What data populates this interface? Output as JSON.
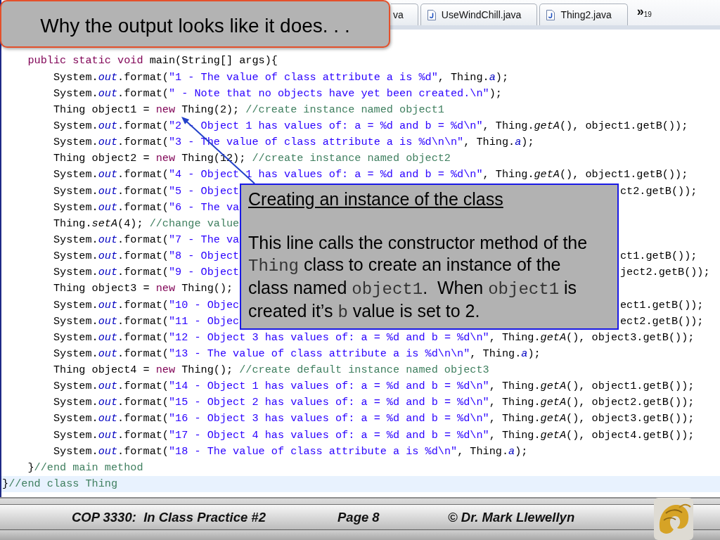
{
  "slide_title": "Why the output looks like it does. . .",
  "editor": {
    "tabs": [
      {
        "label": "va",
        "kind": "partial",
        "selected": false
      },
      {
        "label": "UseWindChill.java",
        "kind": "file",
        "selected": false
      },
      {
        "label": "Thing2.java",
        "kind": "file",
        "selected": false
      }
    ],
    "overflow": {
      "symbol": "»",
      "count": "19"
    },
    "code": [
      {
        "children": [
          {
            "segments": [
              {
                "kind": "keyword",
                "text": "public static void"
              },
              {
                "kind": "plain",
                "text": " main(String[] args){"
              }
            ],
            "highlighted": false,
            "children": [
              {
                "segments": [
                  {
                    "kind": "plain",
                    "text": "System."
                  },
                  {
                    "kind": "field",
                    "text": "out"
                  },
                  {
                    "kind": "plain",
                    "text": ".format("
                  },
                  {
                    "kind": "string",
                    "text": "\"1 - The value of class attribute a is %d\""
                  },
                  {
                    "kind": "plain",
                    "text": ", Thing."
                  },
                  {
                    "kind": "field",
                    "text": "a"
                  },
                  {
                    "kind": "plain",
                    "text": ");"
                  }
                ],
                "highlighted": false
              },
              {
                "segments": [
                  {
                    "kind": "plain",
                    "text": "System."
                  },
                  {
                    "kind": "field",
                    "text": "out"
                  },
                  {
                    "kind": "plain",
                    "text": ".format("
                  },
                  {
                    "kind": "string",
                    "text": "\" - Note that no objects have yet been created.\\n\""
                  },
                  {
                    "kind": "plain",
                    "text": ");"
                  }
                ],
                "highlighted": false
              },
              {
                "segments": [
                  {
                    "kind": "plain",
                    "text": "Thing object1 = "
                  },
                  {
                    "kind": "keyword",
                    "text": "new"
                  },
                  {
                    "kind": "plain",
                    "text": " Thing(2); "
                  },
                  {
                    "kind": "comment",
                    "text": "//create instance named object1"
                  }
                ],
                "highlighted": false
              },
              {
                "segments": [
                  {
                    "kind": "plain",
                    "text": "System."
                  },
                  {
                    "kind": "field",
                    "text": "out"
                  },
                  {
                    "kind": "plain",
                    "text": ".format("
                  },
                  {
                    "kind": "string",
                    "text": "\"2 - Object 1 has values of: a = %d and b = %d\\n\""
                  },
                  {
                    "kind": "plain",
                    "text": ", Thing."
                  },
                  {
                    "kind": "static",
                    "text": "getA"
                  },
                  {
                    "kind": "plain",
                    "text": "(), object1.getB());"
                  }
                ],
                "highlighted": false
              },
              {
                "segments": [
                  {
                    "kind": "plain",
                    "text": "System."
                  },
                  {
                    "kind": "field",
                    "text": "out"
                  },
                  {
                    "kind": "plain",
                    "text": ".format("
                  },
                  {
                    "kind": "string",
                    "text": "\"3 - The value of class attribute a is %d\\n\\n\""
                  },
                  {
                    "kind": "plain",
                    "text": ", Thing."
                  },
                  {
                    "kind": "field",
                    "text": "a"
                  },
                  {
                    "kind": "plain",
                    "text": ");"
                  }
                ],
                "highlighted": false
              },
              {
                "segments": [
                  {
                    "kind": "plain",
                    "text": "Thing object2 = "
                  },
                  {
                    "kind": "keyword",
                    "text": "new"
                  },
                  {
                    "kind": "plain",
                    "text": " Thing(12); "
                  },
                  {
                    "kind": "comment",
                    "text": "//create instance named object2"
                  }
                ],
                "highlighted": false
              },
              {
                "segments": [
                  {
                    "kind": "plain",
                    "text": "System."
                  },
                  {
                    "kind": "field",
                    "text": "out"
                  },
                  {
                    "kind": "plain",
                    "text": ".format("
                  },
                  {
                    "kind": "string",
                    "text": "\"4 - Object 1 has values of: a = %d and b = %d\\n\""
                  },
                  {
                    "kind": "plain",
                    "text": ", Thing."
                  },
                  {
                    "kind": "static",
                    "text": "getA"
                  },
                  {
                    "kind": "plain",
                    "text": "(), object1.getB());"
                  }
                ],
                "highlighted": false
              },
              {
                "segments": [
                  {
                    "kind": "plain",
                    "text": "System."
                  },
                  {
                    "kind": "field",
                    "text": "out"
                  },
                  {
                    "kind": "plain",
                    "text": ".format("
                  },
                  {
                    "kind": "string",
                    "text": "\"5 - Object"
                  }
                ],
                "tail_segments": [
                  {
                    "kind": "plain",
                    "text": "ct2.getB());"
                  }
                ],
                "highlighted": false
              },
              {
                "segments": [
                  {
                    "kind": "plain",
                    "text": "System."
                  },
                  {
                    "kind": "field",
                    "text": "out"
                  },
                  {
                    "kind": "plain",
                    "text": ".format("
                  },
                  {
                    "kind": "string",
                    "text": "\"6 - The va"
                  }
                ],
                "highlighted": false
              },
              {
                "segments": [
                  {
                    "kind": "plain",
                    "text": "Thing."
                  },
                  {
                    "kind": "static",
                    "text": "setA"
                  },
                  {
                    "kind": "plain",
                    "text": "(4); "
                  },
                  {
                    "kind": "comment",
                    "text": "//change value"
                  }
                ],
                "highlighted": false
              },
              {
                "segments": [
                  {
                    "kind": "plain",
                    "text": "System."
                  },
                  {
                    "kind": "field",
                    "text": "out"
                  },
                  {
                    "kind": "plain",
                    "text": ".format("
                  },
                  {
                    "kind": "string",
                    "text": "\"7 - The va"
                  }
                ],
                "highlighted": false
              },
              {
                "segments": [
                  {
                    "kind": "plain",
                    "text": "System."
                  },
                  {
                    "kind": "field",
                    "text": "out"
                  },
                  {
                    "kind": "plain",
                    "text": ".format("
                  },
                  {
                    "kind": "string",
                    "text": "\"8 - Object"
                  }
                ],
                "tail_segments": [
                  {
                    "kind": "plain",
                    "text": "ct1.getB());"
                  }
                ],
                "highlighted": false
              },
              {
                "segments": [
                  {
                    "kind": "plain",
                    "text": "System."
                  },
                  {
                    "kind": "field",
                    "text": "out"
                  },
                  {
                    "kind": "plain",
                    "text": ".format("
                  },
                  {
                    "kind": "string",
                    "text": "\"9 - Object"
                  }
                ],
                "tail_segments": [
                  {
                    "kind": "plain",
                    "text": "ject2.getB());"
                  }
                ],
                "highlighted": false
              },
              {
                "segments": [
                  {
                    "kind": "plain",
                    "text": "Thing object3 = "
                  },
                  {
                    "kind": "keyword",
                    "text": "new"
                  },
                  {
                    "kind": "plain",
                    "text": " Thing();"
                  }
                ],
                "highlighted": false
              },
              {
                "segments": [
                  {
                    "kind": "plain",
                    "text": "System."
                  },
                  {
                    "kind": "field",
                    "text": "out"
                  },
                  {
                    "kind": "plain",
                    "text": ".format("
                  },
                  {
                    "kind": "string",
                    "text": "\"10 - Objec"
                  }
                ],
                "tail_segments": [
                  {
                    "kind": "plain",
                    "text": "ect1.getB());"
                  }
                ],
                "highlighted": false
              },
              {
                "segments": [
                  {
                    "kind": "plain",
                    "text": "System."
                  },
                  {
                    "kind": "field",
                    "text": "out"
                  },
                  {
                    "kind": "plain",
                    "text": ".format("
                  },
                  {
                    "kind": "string",
                    "text": "\"11 - Objec"
                  }
                ],
                "tail_segments": [
                  {
                    "kind": "plain",
                    "text": "ect2.getB());"
                  }
                ],
                "highlighted": false
              },
              {
                "segments": [
                  {
                    "kind": "plain",
                    "text": "System."
                  },
                  {
                    "kind": "field",
                    "text": "out"
                  },
                  {
                    "kind": "plain",
                    "text": ".format("
                  },
                  {
                    "kind": "string",
                    "text": "\"12 - Object 3 has values of: a = %d and b = %d\\n\""
                  },
                  {
                    "kind": "plain",
                    "text": ", Thing."
                  },
                  {
                    "kind": "static",
                    "text": "getA"
                  },
                  {
                    "kind": "plain",
                    "text": "(), object3.getB());"
                  }
                ],
                "highlighted": false
              },
              {
                "segments": [
                  {
                    "kind": "plain",
                    "text": "System."
                  },
                  {
                    "kind": "field",
                    "text": "out"
                  },
                  {
                    "kind": "plain",
                    "text": ".format("
                  },
                  {
                    "kind": "string",
                    "text": "\"13 - The value of class attribute a is %d\\n\\n\""
                  },
                  {
                    "kind": "plain",
                    "text": ", Thing."
                  },
                  {
                    "kind": "field",
                    "text": "a"
                  },
                  {
                    "kind": "plain",
                    "text": ");"
                  }
                ],
                "highlighted": false
              },
              {
                "segments": [
                  {
                    "kind": "plain",
                    "text": "Thing object4 = "
                  },
                  {
                    "kind": "keyword",
                    "text": "new"
                  },
                  {
                    "kind": "plain",
                    "text": " Thing(); "
                  },
                  {
                    "kind": "comment",
                    "text": "//create default instance named object3"
                  }
                ],
                "highlighted": false
              },
              {
                "segments": [
                  {
                    "kind": "plain",
                    "text": "System."
                  },
                  {
                    "kind": "field",
                    "text": "out"
                  },
                  {
                    "kind": "plain",
                    "text": ".format("
                  },
                  {
                    "kind": "string",
                    "text": "\"14 - Object 1 has values of: a = %d and b = %d\\n\""
                  },
                  {
                    "kind": "plain",
                    "text": ", Thing."
                  },
                  {
                    "kind": "static",
                    "text": "getA"
                  },
                  {
                    "kind": "plain",
                    "text": "(), object1.getB());"
                  }
                ],
                "highlighted": false
              },
              {
                "segments": [
                  {
                    "kind": "plain",
                    "text": "System."
                  },
                  {
                    "kind": "field",
                    "text": "out"
                  },
                  {
                    "kind": "plain",
                    "text": ".format("
                  },
                  {
                    "kind": "string",
                    "text": "\"15 - Object 2 has values of: a = %d and b = %d\\n\""
                  },
                  {
                    "kind": "plain",
                    "text": ", Thing."
                  },
                  {
                    "kind": "static",
                    "text": "getA"
                  },
                  {
                    "kind": "plain",
                    "text": "(), object2.getB());"
                  }
                ],
                "highlighted": false
              },
              {
                "segments": [
                  {
                    "kind": "plain",
                    "text": "System."
                  },
                  {
                    "kind": "field",
                    "text": "out"
                  },
                  {
                    "kind": "plain",
                    "text": ".format("
                  },
                  {
                    "kind": "string",
                    "text": "\"16 - Object 3 has values of: a = %d and b = %d\\n\""
                  },
                  {
                    "kind": "plain",
                    "text": ", Thing."
                  },
                  {
                    "kind": "static",
                    "text": "getA"
                  },
                  {
                    "kind": "plain",
                    "text": "(), object3.getB());"
                  }
                ],
                "highlighted": false
              },
              {
                "segments": [
                  {
                    "kind": "plain",
                    "text": "System."
                  },
                  {
                    "kind": "field",
                    "text": "out"
                  },
                  {
                    "kind": "plain",
                    "text": ".format("
                  },
                  {
                    "kind": "string",
                    "text": "\"17 - Object 4 has values of: a = %d and b = %d\\n\""
                  },
                  {
                    "kind": "plain",
                    "text": ", Thing."
                  },
                  {
                    "kind": "static",
                    "text": "getA"
                  },
                  {
                    "kind": "plain",
                    "text": "(), object4.getB());"
                  }
                ],
                "highlighted": false
              },
              {
                "segments": [
                  {
                    "kind": "plain",
                    "text": "System."
                  },
                  {
                    "kind": "field",
                    "text": "out"
                  },
                  {
                    "kind": "plain",
                    "text": ".format("
                  },
                  {
                    "kind": "string",
                    "text": "\"18 - The value of class attribute a is %d\\n\""
                  },
                  {
                    "kind": "plain",
                    "text": ", Thing."
                  },
                  {
                    "kind": "field",
                    "text": "a"
                  },
                  {
                    "kind": "plain",
                    "text": ");"
                  }
                ],
                "highlighted": false
              }
            ]
          },
          {
            "segments": [
              {
                "kind": "plain",
                "text": "}"
              },
              {
                "kind": "comment",
                "text": "//end main method"
              }
            ],
            "highlighted": false
          }
        ]
      },
      {
        "segments": [
          {
            "kind": "plain",
            "text": "}"
          },
          {
            "kind": "comment",
            "text": "//end class Thing"
          }
        ],
        "highlighted": true
      }
    ]
  },
  "callout": {
    "heading": "Creating an instance of the class",
    "body": [
      {
        "kind": "text",
        "text": "This line calls the constructor method of the "
      },
      {
        "kind": "code",
        "text": "Thing"
      },
      {
        "kind": "text",
        "text": " class to create an instance of the class named "
      },
      {
        "kind": "code",
        "text": "object1"
      },
      {
        "kind": "text",
        "text": ".  When "
      },
      {
        "kind": "code",
        "text": "object1"
      },
      {
        "kind": "text",
        "text": " is created it’s "
      },
      {
        "kind": "code",
        "text": "b"
      },
      {
        "kind": "text",
        "text": " value is set to 2."
      }
    ]
  },
  "footer": {
    "course": "COP 3330:  In Class Practice #2",
    "page": "Page 8",
    "author": "© Dr. Mark Llewellyn"
  }
}
